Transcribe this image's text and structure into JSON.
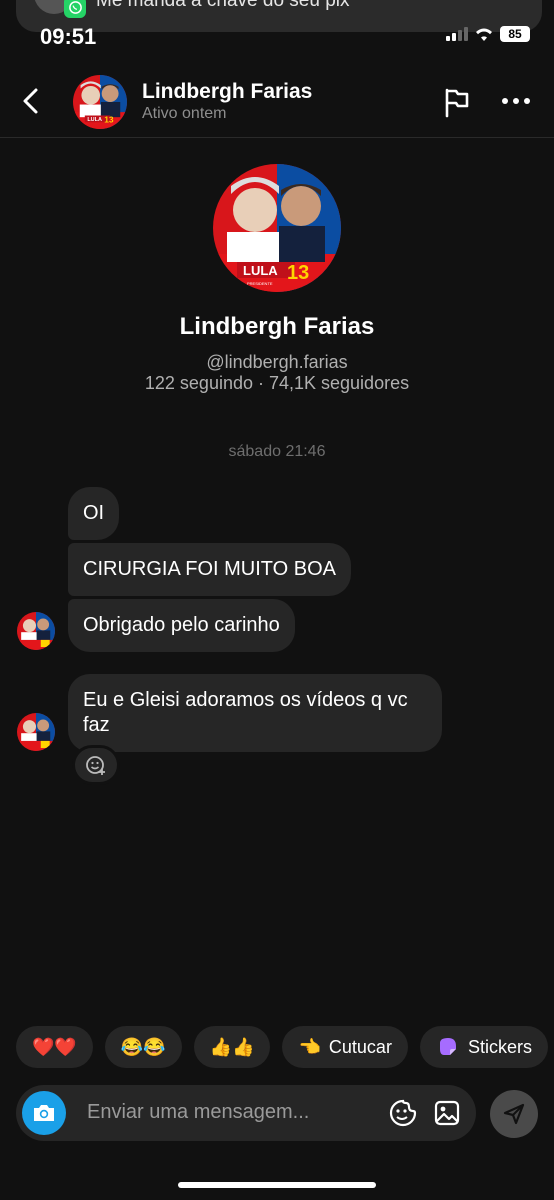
{
  "notification": {
    "text": "Me manda a chave do seu pix",
    "app_icon": "whatsapp-icon"
  },
  "status_bar": {
    "time": "09:51",
    "battery": "85"
  },
  "header": {
    "name": "Lindbergh Farias",
    "status": "Ativo ontem"
  },
  "avatar": {
    "badge_text": "LULA",
    "badge_number": "13",
    "badge_sub": "PRESIDENTE"
  },
  "profile": {
    "name": "Lindbergh Farias",
    "handle": "@lindbergh.farias",
    "stats": "122 seguindo · 74,1K seguidores"
  },
  "thread": {
    "timestamp": "sábado 21:46",
    "messages": [
      {
        "text": "OI"
      },
      {
        "text": "CIRURGIA FOI MUITO BOA"
      },
      {
        "text": "Obrigado pelo carinho"
      },
      {
        "text": "Eu e Gleisi adoramos os vídeos q vc faz"
      }
    ]
  },
  "quick_replies": [
    {
      "emoji": "❤️❤️",
      "label": ""
    },
    {
      "emoji": "😂😂",
      "label": ""
    },
    {
      "emoji": "👍👍",
      "label": ""
    },
    {
      "emoji": "👈",
      "label": "Cutucar"
    },
    {
      "emoji": "",
      "label": "Stickers"
    }
  ],
  "composer": {
    "placeholder": "Enviar uma mensagem..."
  },
  "colors": {
    "background": "#111111",
    "bubble": "#262626",
    "camera": "#1aa0e8",
    "lula_red": "#e3161b",
    "lula_yellow": "#ffd400"
  }
}
